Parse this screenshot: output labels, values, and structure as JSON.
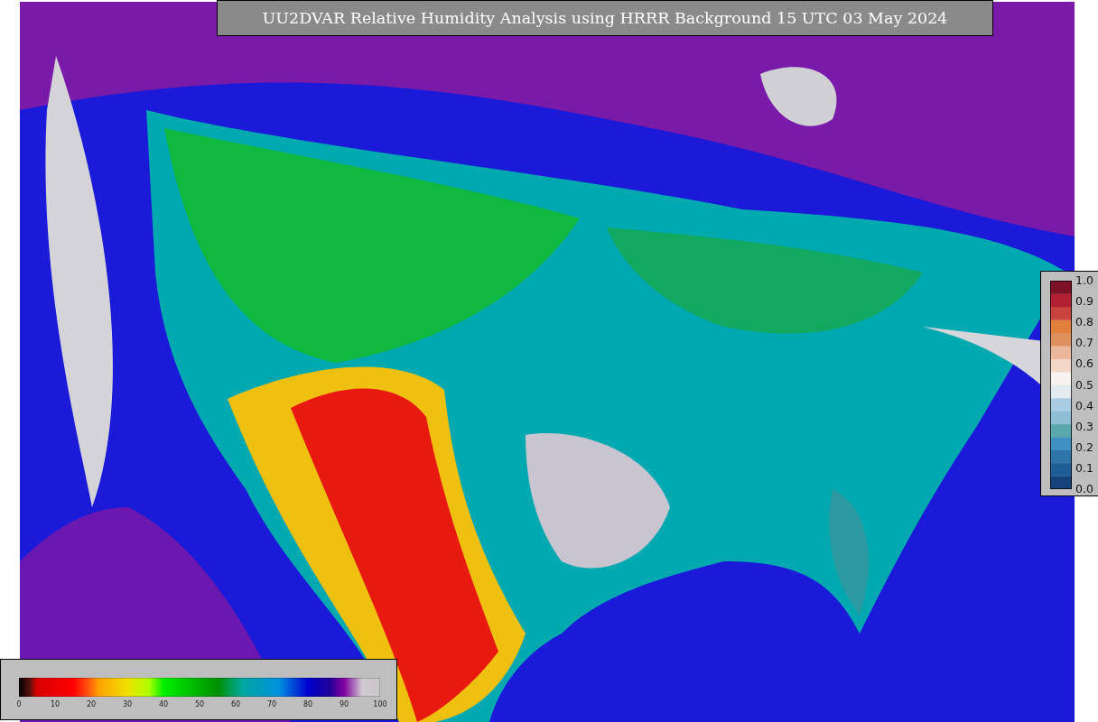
{
  "title": "UU2DVAR Relative Humidity Analysis using HRRR Background 15 UTC 03 May 2024",
  "humidity_colorbar": {
    "ticks": [
      "0",
      "10",
      "20",
      "30",
      "40",
      "50",
      "60",
      "70",
      "80",
      "90",
      "100"
    ]
  },
  "observation_colorbar": {
    "ticks": [
      "1.0",
      "0.9",
      "0.8",
      "0.7",
      "0.6",
      "0.5",
      "0.4",
      "0.3",
      "0.2",
      "0.1",
      "0.0"
    ]
  }
}
